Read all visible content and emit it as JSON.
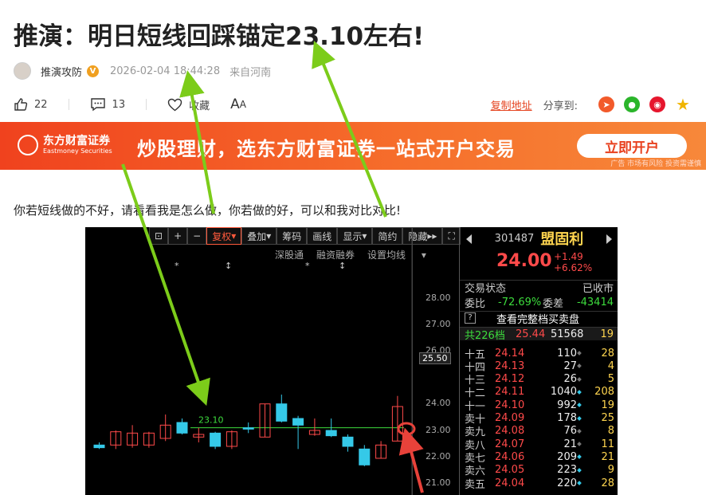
{
  "article": {
    "title": "推演：明日短线回踩锚定23.10左右!",
    "author": "推演攻防",
    "verified_badge": "V",
    "time": "2026-02-04 18:44:28",
    "location": "来自河南",
    "body": "你若短线做的不好，请看看我是怎么做，你若做的好，可以和我对比对比!"
  },
  "actions": {
    "likes": "22",
    "comments": "13",
    "favorite_label": "收藏",
    "font_label_big": "A",
    "font_label_small": "A",
    "copy_link": "复制地址",
    "share_label": "分享到:"
  },
  "banner": {
    "logo_cn": "东方财富证券",
    "logo_en": "Eastmoney Securities",
    "slogan": "炒股理财，选东方财富证券一站式开户交易",
    "button": "立即开户",
    "note": "广告  市场有风险 投资需谨慎"
  },
  "chart_toolbar": [
    "复权",
    "叠加",
    "筹码",
    "画线",
    "显示",
    "简约",
    "隐藏"
  ],
  "chart_subbar": [
    "深股通",
    "融资融券",
    "设置均线"
  ],
  "chart_data": {
    "type": "candlestick",
    "annotation": "23.10",
    "price_ticks": [
      "28.00",
      "27.00",
      "26.00",
      "25.50",
      "24.00",
      "23.00",
      "22.00",
      "21.00"
    ],
    "current_price_label": "25.50",
    "candles": [
      {
        "o": 22.45,
        "c": 22.35,
        "h": 22.55,
        "l": 22.3
      },
      {
        "o": 22.45,
        "c": 22.95,
        "h": 23.0,
        "l": 22.3
      },
      {
        "o": 22.45,
        "c": 22.9,
        "h": 23.2,
        "l": 22.35
      },
      {
        "o": 22.45,
        "c": 22.9,
        "h": 22.95,
        "l": 22.35
      },
      {
        "o": 22.7,
        "c": 23.2,
        "h": 23.6,
        "l": 22.6
      },
      {
        "o": 23.3,
        "c": 22.9,
        "h": 23.45,
        "l": 22.85
      },
      {
        "o": 22.75,
        "c": 22.85,
        "h": 23.1,
        "l": 22.55
      },
      {
        "o": 22.9,
        "c": 22.4,
        "h": 22.95,
        "l": 22.3
      },
      {
        "o": 22.4,
        "c": 22.95,
        "h": 23.0,
        "l": 22.3
      },
      {
        "o": 23.1,
        "c": 23.05,
        "h": 23.3,
        "l": 22.9
      },
      {
        "o": 22.75,
        "c": 24.0,
        "h": 24.0,
        "l": 22.75
      },
      {
        "o": 24.0,
        "c": 23.35,
        "h": 24.35,
        "l": 23.3
      },
      {
        "o": 23.45,
        "c": 23.2,
        "h": 23.55,
        "l": 22.3
      },
      {
        "o": 22.85,
        "c": 23.0,
        "h": 23.45,
        "l": 22.8
      },
      {
        "o": 23.0,
        "c": 22.8,
        "h": 23.45,
        "l": 22.75
      },
      {
        "o": 22.75,
        "c": 22.4,
        "h": 22.85,
        "l": 22.2
      },
      {
        "o": 22.3,
        "c": 21.7,
        "h": 22.45,
        "l": 21.65
      },
      {
        "o": 21.95,
        "c": 22.45,
        "h": 22.6,
        "l": 21.95
      },
      {
        "o": 22.6,
        "c": 23.9,
        "h": 24.3,
        "l": 22.6
      }
    ]
  },
  "quote": {
    "code": "301487",
    "name": "盟固利",
    "price": "24.00",
    "change": "+1.49",
    "change_pct": "+6.62%",
    "status_label": "交易状态",
    "status_value": "已收市",
    "weibi_label": "委比",
    "weibi_value": "-72.69%",
    "weicha_label": "委差",
    "weicha_value": "-43414",
    "full_book_label": "查看完整档买卖盘",
    "help_icon": "?",
    "total_label": "共226档",
    "total_price": "25.44",
    "total_vol": "51568",
    "total_count": "19",
    "levels": [
      {
        "label": "十五",
        "price": "24.14",
        "vol": "110",
        "n": "28",
        "cyan": false
      },
      {
        "label": "十四",
        "price": "24.13",
        "vol": "27",
        "n": "4",
        "cyan": false
      },
      {
        "label": "十三",
        "price": "24.12",
        "vol": "26",
        "n": "5",
        "cyan": false
      },
      {
        "label": "十二",
        "price": "24.11",
        "vol": "1040",
        "n": "208",
        "cyan": true
      },
      {
        "label": "十一",
        "price": "24.10",
        "vol": "992",
        "n": "19",
        "cyan": true
      },
      {
        "label": "卖十",
        "price": "24.09",
        "vol": "178",
        "n": "25",
        "cyan": true
      },
      {
        "label": "卖九",
        "price": "24.08",
        "vol": "76",
        "n": "8",
        "cyan": false
      },
      {
        "label": "卖八",
        "price": "24.07",
        "vol": "21",
        "n": "11",
        "cyan": false
      },
      {
        "label": "卖七",
        "price": "24.06",
        "vol": "209",
        "n": "21",
        "cyan": true
      },
      {
        "label": "卖六",
        "price": "24.05",
        "vol": "223",
        "n": "9",
        "cyan": true
      },
      {
        "label": "卖五",
        "price": "24.04",
        "vol": "220",
        "n": "28",
        "cyan": true
      }
    ]
  }
}
